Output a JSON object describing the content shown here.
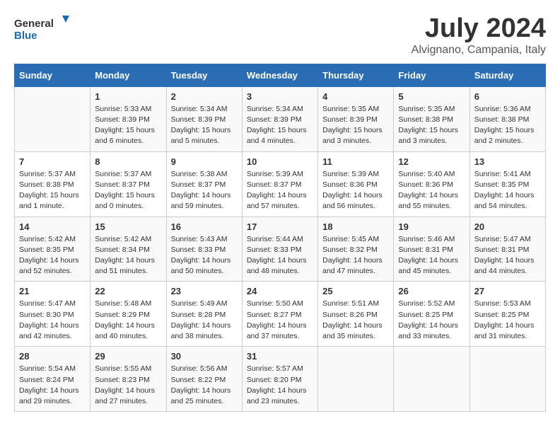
{
  "logo": {
    "line1": "General",
    "line2": "Blue"
  },
  "title": {
    "month_year": "July 2024",
    "location": "Alvignano, Campania, Italy"
  },
  "header_days": [
    "Sunday",
    "Monday",
    "Tuesday",
    "Wednesday",
    "Thursday",
    "Friday",
    "Saturday"
  ],
  "weeks": [
    {
      "days": [
        {
          "num": "",
          "info": ""
        },
        {
          "num": "1",
          "info": "Sunrise: 5:33 AM\nSunset: 8:39 PM\nDaylight: 15 hours\nand 6 minutes."
        },
        {
          "num": "2",
          "info": "Sunrise: 5:34 AM\nSunset: 8:39 PM\nDaylight: 15 hours\nand 5 minutes."
        },
        {
          "num": "3",
          "info": "Sunrise: 5:34 AM\nSunset: 8:39 PM\nDaylight: 15 hours\nand 4 minutes."
        },
        {
          "num": "4",
          "info": "Sunrise: 5:35 AM\nSunset: 8:39 PM\nDaylight: 15 hours\nand 3 minutes."
        },
        {
          "num": "5",
          "info": "Sunrise: 5:35 AM\nSunset: 8:38 PM\nDaylight: 15 hours\nand 3 minutes."
        },
        {
          "num": "6",
          "info": "Sunrise: 5:36 AM\nSunset: 8:38 PM\nDaylight: 15 hours\nand 2 minutes."
        }
      ]
    },
    {
      "days": [
        {
          "num": "7",
          "info": "Sunrise: 5:37 AM\nSunset: 8:38 PM\nDaylight: 15 hours\nand 1 minute."
        },
        {
          "num": "8",
          "info": "Sunrise: 5:37 AM\nSunset: 8:37 PM\nDaylight: 15 hours\nand 0 minutes."
        },
        {
          "num": "9",
          "info": "Sunrise: 5:38 AM\nSunset: 8:37 PM\nDaylight: 14 hours\nand 59 minutes."
        },
        {
          "num": "10",
          "info": "Sunrise: 5:39 AM\nSunset: 8:37 PM\nDaylight: 14 hours\nand 57 minutes."
        },
        {
          "num": "11",
          "info": "Sunrise: 5:39 AM\nSunset: 8:36 PM\nDaylight: 14 hours\nand 56 minutes."
        },
        {
          "num": "12",
          "info": "Sunrise: 5:40 AM\nSunset: 8:36 PM\nDaylight: 14 hours\nand 55 minutes."
        },
        {
          "num": "13",
          "info": "Sunrise: 5:41 AM\nSunset: 8:35 PM\nDaylight: 14 hours\nand 54 minutes."
        }
      ]
    },
    {
      "days": [
        {
          "num": "14",
          "info": "Sunrise: 5:42 AM\nSunset: 8:35 PM\nDaylight: 14 hours\nand 52 minutes."
        },
        {
          "num": "15",
          "info": "Sunrise: 5:42 AM\nSunset: 8:34 PM\nDaylight: 14 hours\nand 51 minutes."
        },
        {
          "num": "16",
          "info": "Sunrise: 5:43 AM\nSunset: 8:33 PM\nDaylight: 14 hours\nand 50 minutes."
        },
        {
          "num": "17",
          "info": "Sunrise: 5:44 AM\nSunset: 8:33 PM\nDaylight: 14 hours\nand 48 minutes."
        },
        {
          "num": "18",
          "info": "Sunrise: 5:45 AM\nSunset: 8:32 PM\nDaylight: 14 hours\nand 47 minutes."
        },
        {
          "num": "19",
          "info": "Sunrise: 5:46 AM\nSunset: 8:31 PM\nDaylight: 14 hours\nand 45 minutes."
        },
        {
          "num": "20",
          "info": "Sunrise: 5:47 AM\nSunset: 8:31 PM\nDaylight: 14 hours\nand 44 minutes."
        }
      ]
    },
    {
      "days": [
        {
          "num": "21",
          "info": "Sunrise: 5:47 AM\nSunset: 8:30 PM\nDaylight: 14 hours\nand 42 minutes."
        },
        {
          "num": "22",
          "info": "Sunrise: 5:48 AM\nSunset: 8:29 PM\nDaylight: 14 hours\nand 40 minutes."
        },
        {
          "num": "23",
          "info": "Sunrise: 5:49 AM\nSunset: 8:28 PM\nDaylight: 14 hours\nand 38 minutes."
        },
        {
          "num": "24",
          "info": "Sunrise: 5:50 AM\nSunset: 8:27 PM\nDaylight: 14 hours\nand 37 minutes."
        },
        {
          "num": "25",
          "info": "Sunrise: 5:51 AM\nSunset: 8:26 PM\nDaylight: 14 hours\nand 35 minutes."
        },
        {
          "num": "26",
          "info": "Sunrise: 5:52 AM\nSunset: 8:25 PM\nDaylight: 14 hours\nand 33 minutes."
        },
        {
          "num": "27",
          "info": "Sunrise: 5:53 AM\nSunset: 8:25 PM\nDaylight: 14 hours\nand 31 minutes."
        }
      ]
    },
    {
      "days": [
        {
          "num": "28",
          "info": "Sunrise: 5:54 AM\nSunset: 8:24 PM\nDaylight: 14 hours\nand 29 minutes."
        },
        {
          "num": "29",
          "info": "Sunrise: 5:55 AM\nSunset: 8:23 PM\nDaylight: 14 hours\nand 27 minutes."
        },
        {
          "num": "30",
          "info": "Sunrise: 5:56 AM\nSunset: 8:22 PM\nDaylight: 14 hours\nand 25 minutes."
        },
        {
          "num": "31",
          "info": "Sunrise: 5:57 AM\nSunset: 8:20 PM\nDaylight: 14 hours\nand 23 minutes."
        },
        {
          "num": "",
          "info": ""
        },
        {
          "num": "",
          "info": ""
        },
        {
          "num": "",
          "info": ""
        }
      ]
    }
  ]
}
